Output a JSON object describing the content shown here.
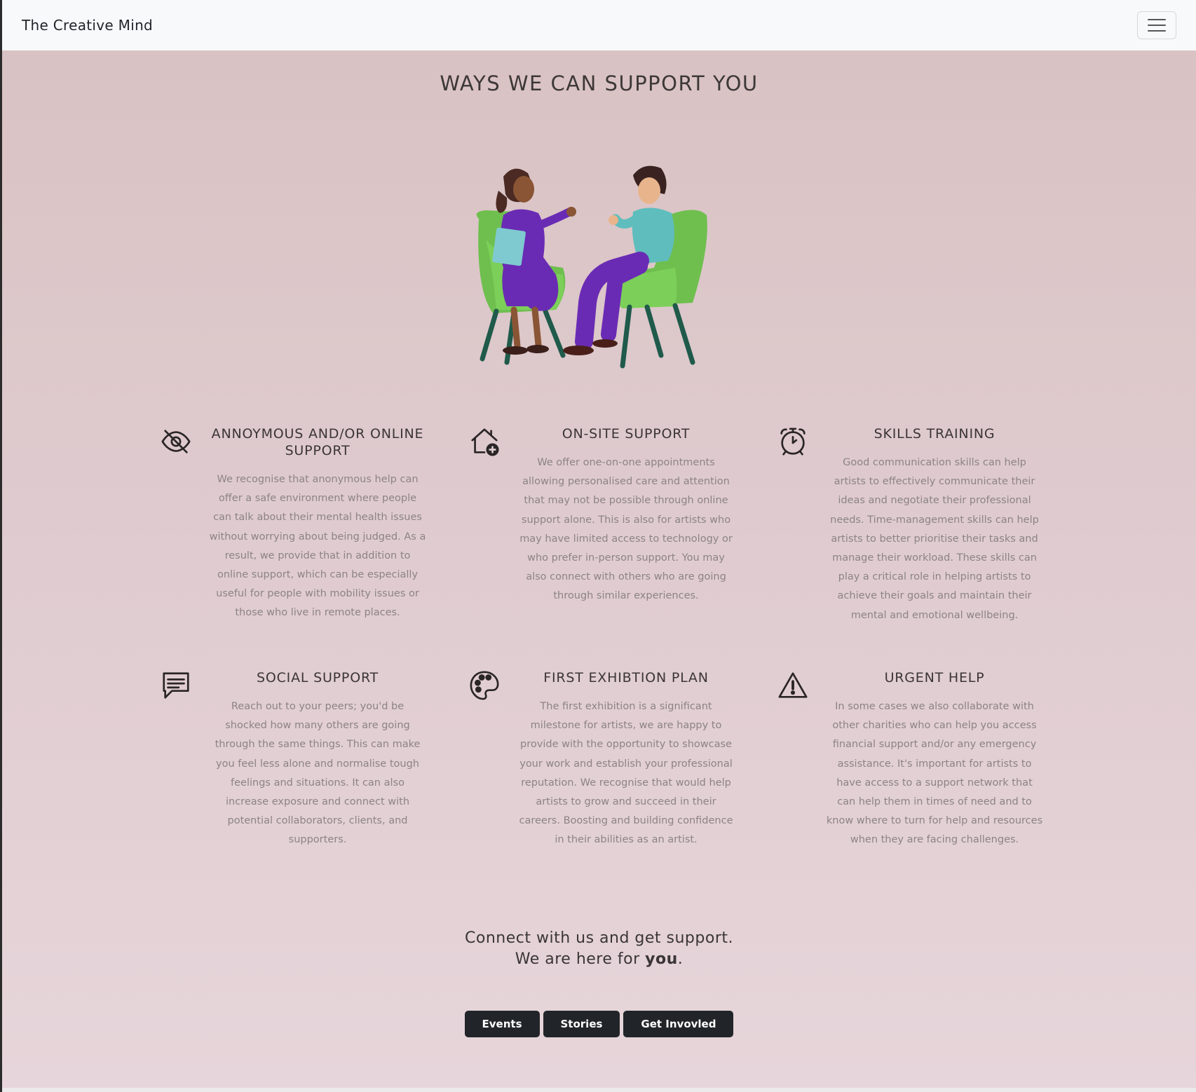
{
  "navbar": {
    "brand": "The Creative Mind",
    "menu_toggle_icon": "hamburger-menu-icon"
  },
  "main": {
    "title": "WAYS WE CAN SUPPORT YOU",
    "illustration": "two-people-talking-in-chairs",
    "cards": [
      {
        "icon": "eye-slash-icon",
        "title": "ANNOYMOUS AND/OR ONLINE SUPPORT",
        "text": "We recognise that anonymous help can offer a safe environment where people can talk about their mental health issues without worrying about being judged. As a result, we provide that in addition to online support, which can be especially useful for people with mobility issues or those who live in remote places."
      },
      {
        "icon": "house-add-icon",
        "title": "ON-SITE SUPPORT",
        "text": "We offer one-on-one appointments allowing personalised care and attention that may not be possible through online support alone. This is also for artists who may have limited access to technology or who prefer in-person support. You may also connect with others who are going through similar experiences."
      },
      {
        "icon": "alarm-clock-icon",
        "title": "SKILLS TRAINING",
        "text": "Good communication skills can help artists to effectively communicate their ideas and negotiate their professional needs. Time-management skills can help artists to better prioritise their tasks and manage their workload. These skills can play a critical role in helping artists to achieve their goals and maintain their mental and emotional wellbeing."
      },
      {
        "icon": "chat-text-icon",
        "title": "SOCIAL SUPPORT",
        "text": "Reach out to your peers; you'd be shocked how many others are going through the same things. This can make you feel less alone and normalise tough feelings and situations. It can also increase exposure and connect with potential collaborators, clients, and supporters."
      },
      {
        "icon": "palette-icon",
        "title": "FIRST EXHIBTION PLAN",
        "text": "The first exhibition is a significant milestone for artists, we are happy to provide with the opportunity to showcase your work and establish your professional reputation. We recognise that would help artists to grow and succeed in their careers. Boosting and building confidence in their abilities as an artist."
      },
      {
        "icon": "warning-triangle-icon",
        "title": "URGENT HELP",
        "text": "In some cases we also collaborate with other charities who can help you access financial support and/or any emergency assistance. It's important for artists to have access to a support network that can help them in times of need and to know where to turn for help and resources when they are facing challenges."
      }
    ],
    "connect": {
      "line1": "Connect with us and get support.",
      "line2_prefix": "We are here for ",
      "line2_bold": "you",
      "line2_suffix": "."
    },
    "buttons": {
      "events": "Events",
      "stories": "Stories",
      "get_involved": "Get Invovled"
    }
  },
  "colors": {
    "background_top": "#d9c2c3",
    "background_bottom": "#e6d5da",
    "button_bg": "#212529",
    "navbar_bg": "#f8f9fa"
  }
}
